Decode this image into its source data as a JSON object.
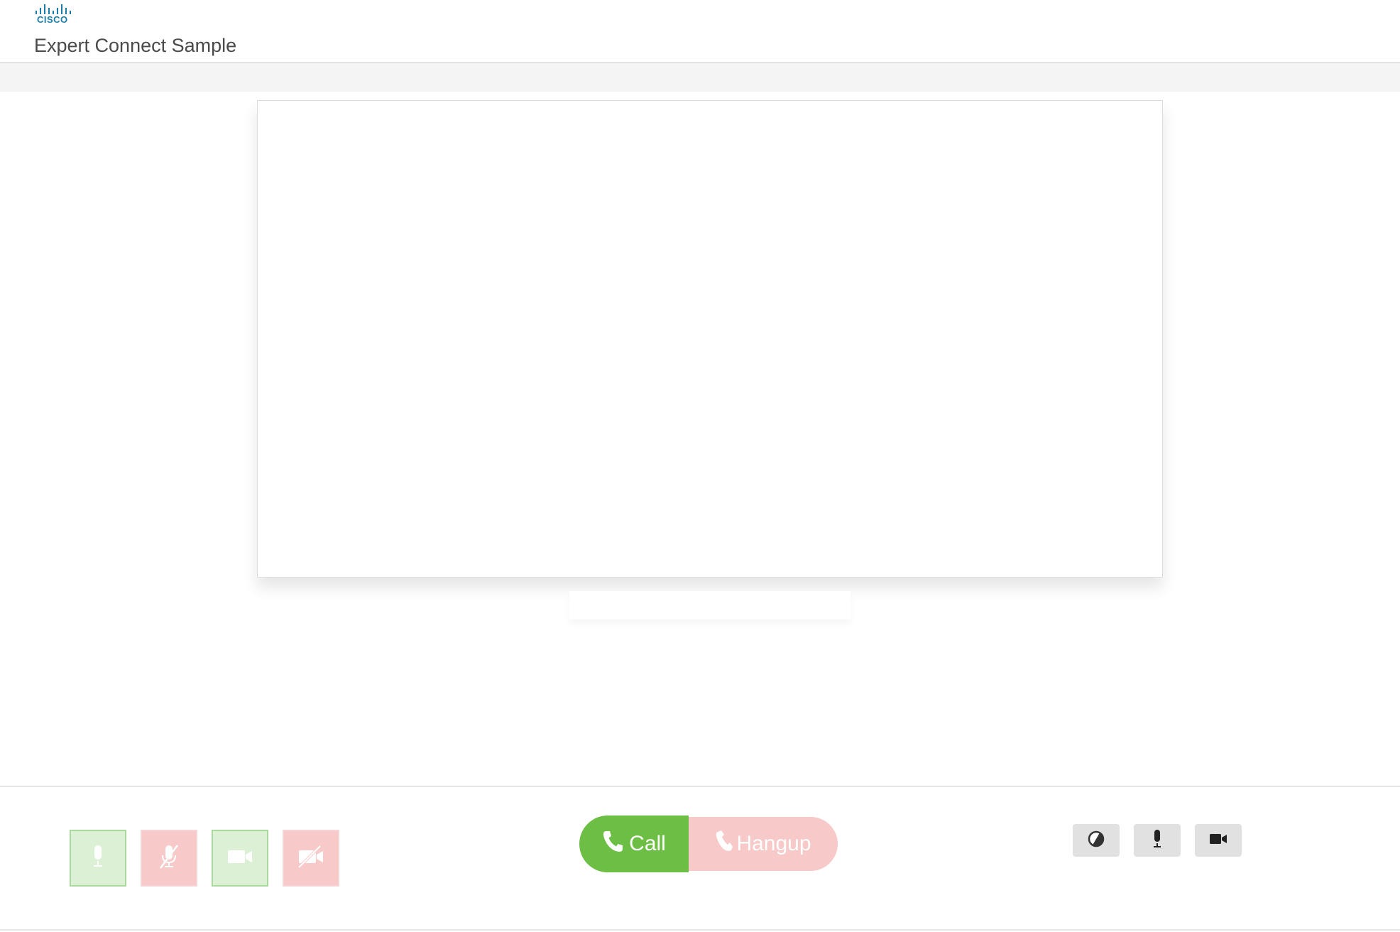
{
  "header": {
    "logo_text": "CISCO",
    "title": "Expert Connect Sample"
  },
  "controls": {
    "left": [
      {
        "name": "mic-on-button",
        "icon": "microphone-icon",
        "state": "green"
      },
      {
        "name": "mic-off-button",
        "icon": "microphone-muted-icon",
        "state": "red"
      },
      {
        "name": "video-on-button",
        "icon": "video-camera-icon",
        "state": "green"
      },
      {
        "name": "video-off-button",
        "icon": "video-camera-off-icon",
        "state": "red"
      }
    ],
    "call_label": "Call",
    "hangup_label": "Hangup",
    "right": [
      {
        "name": "contrast-button",
        "icon": "contrast-icon"
      },
      {
        "name": "microphone-button",
        "icon": "microphone-icon"
      },
      {
        "name": "camera-button",
        "icon": "video-camera-icon"
      }
    ]
  },
  "colors": {
    "brand": "#1a7da8",
    "call_green": "#6cbe45",
    "hangup_pink": "#f7c9c8",
    "green_tint": "#dcf0d6",
    "red_tint": "#f7c9c8",
    "icon_green": "#ffffff",
    "icon_red": "#ffffff",
    "gray_button": "#e1e1e1"
  }
}
